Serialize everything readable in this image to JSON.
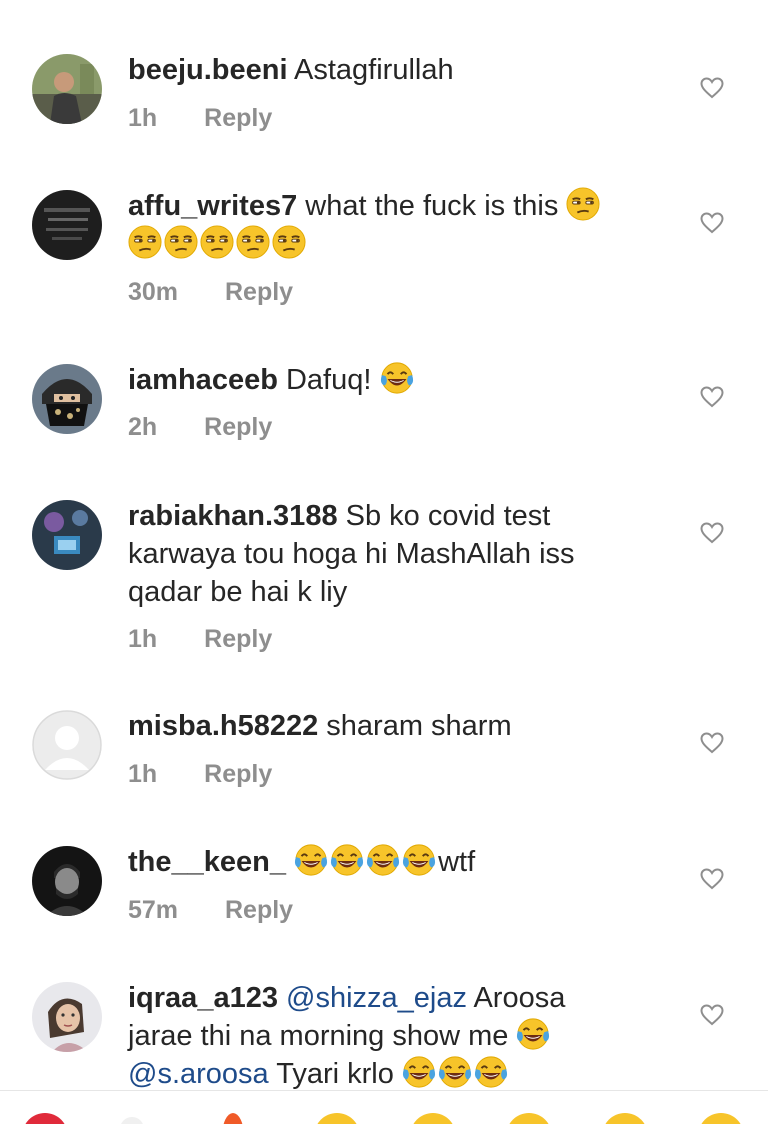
{
  "comments": [
    {
      "username": "beeju.beeni",
      "text": "Astagfirullah",
      "time": "1h",
      "reply": "Reply"
    },
    {
      "username": "affu_writes7",
      "text": "what the fuck is this",
      "time": "30m",
      "reply": "Reply"
    },
    {
      "username": "iamhaceeb",
      "text": "Dafuq!",
      "time": "2h",
      "reply": "Reply"
    },
    {
      "username": "rabiakhan.3188",
      "text_line1": "Sb ko covid test",
      "text_line2": "karwaya tou hoga hi MashAllah iss",
      "text_line3": "qadar be hai k liy",
      "time": "1h",
      "reply": "Reply"
    },
    {
      "username": "misba.h58222",
      "text": "sharam sharm",
      "time": "1h",
      "reply": "Reply"
    },
    {
      "username": "the__keen_",
      "text": "wtf",
      "time": "57m",
      "reply": "Reply"
    },
    {
      "username": "iqraa_a123",
      "mention1": "@shizza_ejaz",
      "text_line1": " Aroosa",
      "text_line2": "jarae thi na morning show me",
      "mention2": "@s.aroosa",
      "text_line3": " Tyari krlo"
    }
  ],
  "icons": {
    "heart": "heart-outline-icon",
    "unamused": "unamused-face-emoji",
    "laughing": "tears-of-joy-emoji"
  },
  "colors": {
    "text": "#262626",
    "meta": "#8e8e8e",
    "mention": "#1e4b8a",
    "emoji_face": "#f7c42a",
    "tears": "#4aa3e0"
  }
}
